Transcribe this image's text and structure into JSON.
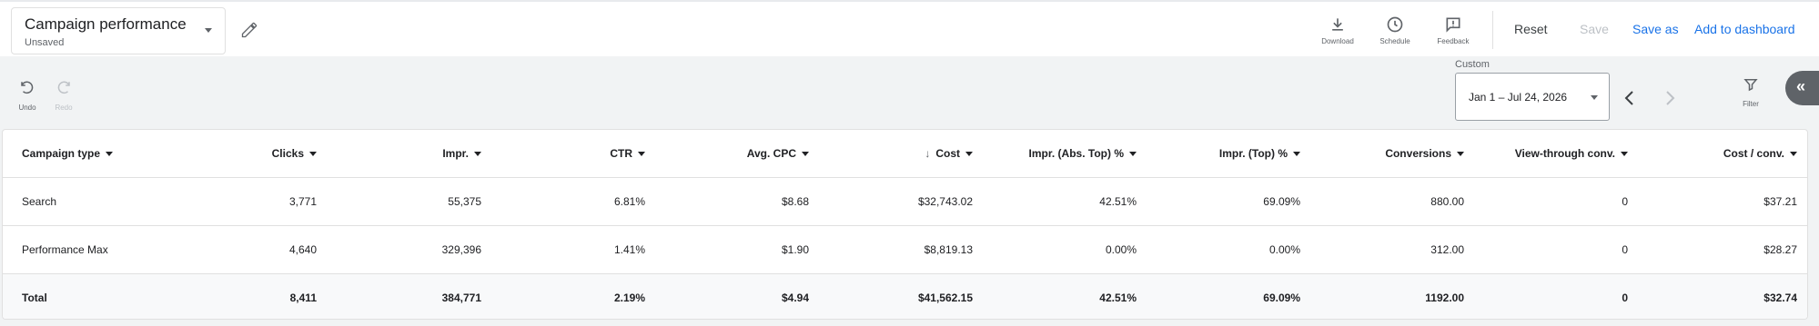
{
  "report": {
    "title": "Campaign performance",
    "status": "Unsaved"
  },
  "toolbar": {
    "download": "Download",
    "schedule": "Schedule",
    "feedback": "Feedback",
    "reset": "Reset",
    "save": "Save",
    "save_as": "Save as",
    "add_to_dashboard": "Add to dashboard"
  },
  "history": {
    "undo": "Undo",
    "redo": "Redo"
  },
  "date_range": {
    "label": "Custom",
    "value": "Jan 1 – Jul 24, 2026"
  },
  "filter": {
    "label": "Filter"
  },
  "colors": {
    "accent": "#1a73e8",
    "disabled": "#bdc1c6",
    "header_bg": "#ffffff",
    "total_bg": "#f8f9fa"
  },
  "table": {
    "columns": [
      "Campaign type",
      "Clicks",
      "Impr.",
      "CTR",
      "Avg. CPC",
      "Cost",
      "Impr. (Abs. Top) %",
      "Impr. (Top) %",
      "Conversions",
      "View-through conv.",
      "Cost / conv."
    ],
    "sorted_column": "Cost",
    "rows": [
      [
        "Search",
        "3,771",
        "55,375",
        "6.81%",
        "$8.68",
        "$32,743.02",
        "42.51%",
        "69.09%",
        "880.00",
        "0",
        "$37.21"
      ],
      [
        "Performance Max",
        "4,640",
        "329,396",
        "1.41%",
        "$1.90",
        "$8,819.13",
        "0.00%",
        "0.00%",
        "312.00",
        "0",
        "$28.27"
      ]
    ],
    "total": [
      "Total",
      "8,411",
      "384,771",
      "2.19%",
      "$4.94",
      "$41,562.15",
      "42.51%",
      "69.09%",
      "1192.00",
      "0",
      "$32.74"
    ]
  }
}
